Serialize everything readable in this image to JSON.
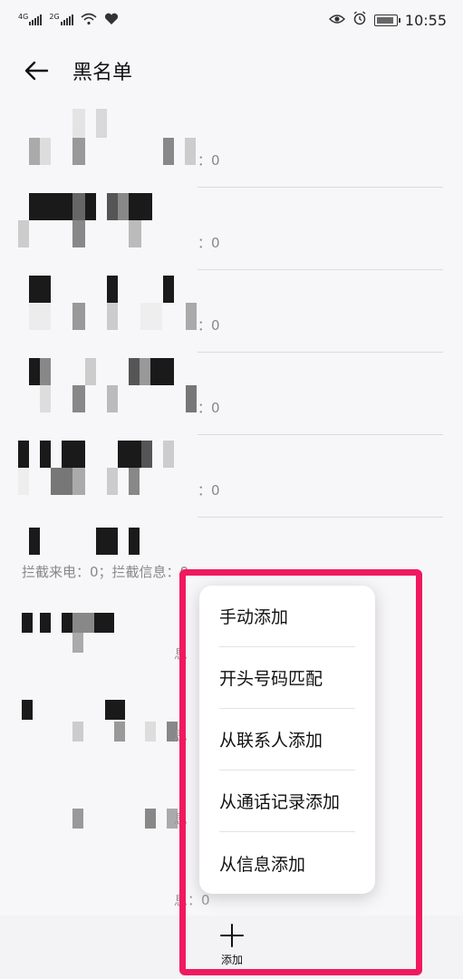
{
  "status": {
    "net1": "4G",
    "net2": "2G",
    "time": "10:55"
  },
  "header": {
    "title": "黑名单"
  },
  "list": {
    "rows": [
      {
        "count": "：0"
      },
      {
        "count": "：0"
      },
      {
        "count": "：0"
      },
      {
        "count": "：0"
      },
      {
        "count": "：0"
      }
    ],
    "sixth_row_text": "拦截来电：0；拦截信息：0",
    "partial_labels": [
      "息",
      "息",
      "息",
      "息：0"
    ]
  },
  "menu": {
    "items": [
      "手动添加",
      "开头号码匹配",
      "从联系人添加",
      "从通话记录添加",
      "从信息添加"
    ]
  },
  "bottom": {
    "add_label": "添加"
  },
  "colors": {
    "highlight": "#f0195f",
    "background": "#f7f6f8"
  }
}
